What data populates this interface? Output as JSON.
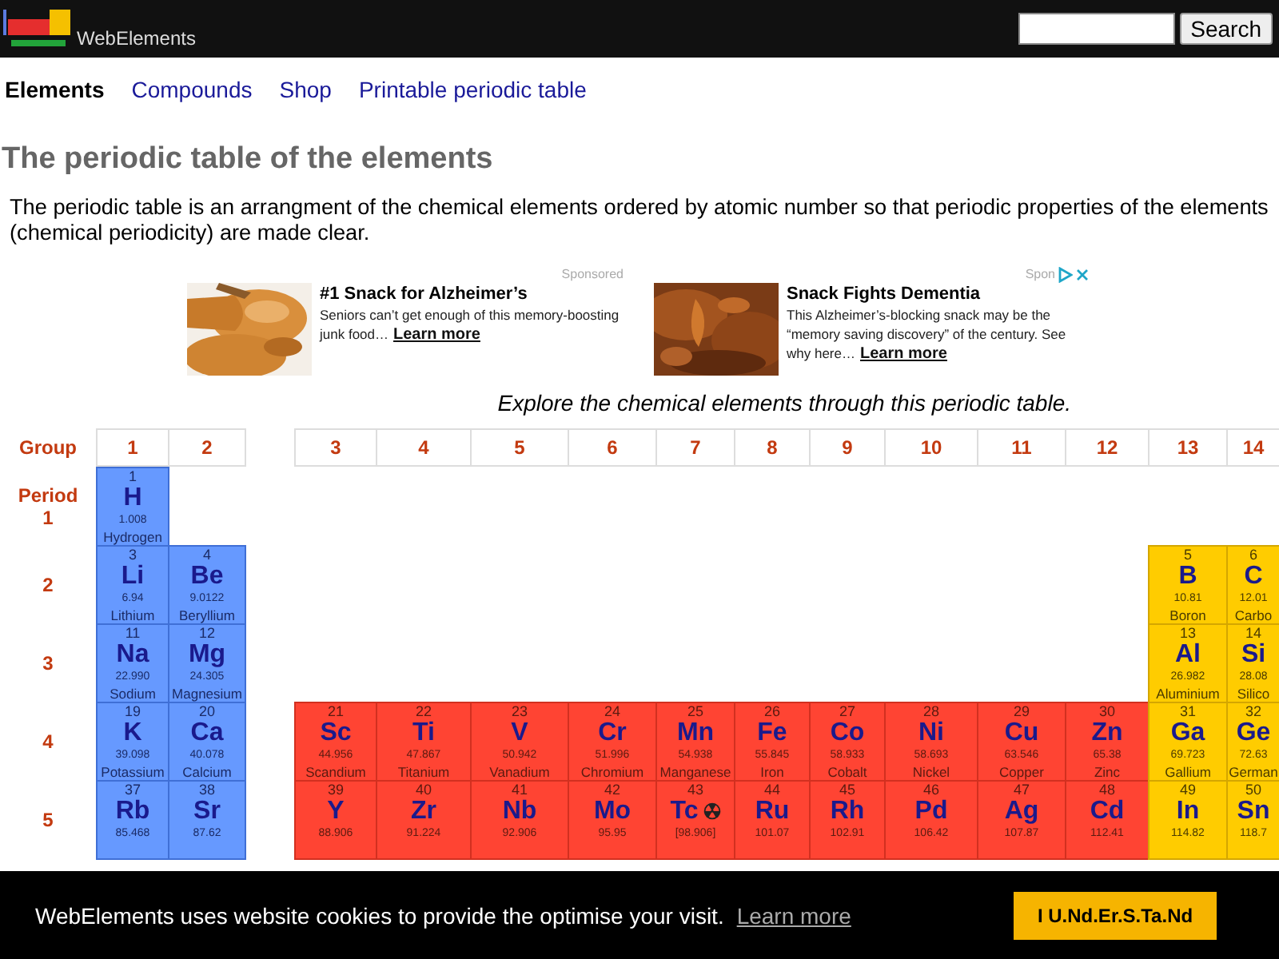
{
  "header": {
    "site_name": "WebElements",
    "search_button": "Search"
  },
  "nav": [
    {
      "label": "Elements",
      "selected": true
    },
    {
      "label": "Compounds",
      "selected": false
    },
    {
      "label": "Shop",
      "selected": false
    },
    {
      "label": "Printable periodic table",
      "selected": false
    }
  ],
  "title": "The periodic table of the elements",
  "intro": "The periodic table is an arrangment of the chemical elements ordered by atomic number so that periodic properties of the elements (chemical periodicity) are made clear.",
  "ads": [
    {
      "sponsored": "Sponsored",
      "title": "#1 Snack for Alzheimer’s",
      "text": "Seniors can’t get enough of this memory-boosting junk food…",
      "link": "Learn more",
      "ad_choices": false
    },
    {
      "sponsored": "Spon",
      "title": "Snack Fights Dementia",
      "text": "This Alzheimer’s-blocking snack may be the “memory saving discovery” of the century. See why here…",
      "link": "Learn more",
      "ad_choices": true
    }
  ],
  "explore": "Explore the chemical elements through this periodic table.",
  "table": {
    "group_label": "Group",
    "period_label": "Period",
    "groups": [
      "1",
      "2",
      "3",
      "4",
      "5",
      "6",
      "7",
      "8",
      "9",
      "10",
      "11",
      "12",
      "13",
      "14"
    ],
    "periods": [
      {
        "label": "1",
        "cells": [
          {
            "kind": "s-block",
            "number": "1",
            "symbol": "H",
            "weight": "1.008",
            "name": "Hydrogen"
          },
          {
            "kind": "empty"
          },
          {
            "kind": "empty"
          },
          {
            "kind": "empty"
          },
          {
            "kind": "empty"
          },
          {
            "kind": "empty"
          },
          {
            "kind": "empty"
          },
          {
            "kind": "empty"
          },
          {
            "kind": "empty"
          },
          {
            "kind": "empty"
          },
          {
            "kind": "empty"
          },
          {
            "kind": "empty"
          },
          {
            "kind": "empty"
          },
          {
            "kind": "empty"
          }
        ]
      },
      {
        "label": "2",
        "cells": [
          {
            "kind": "s-block",
            "number": "3",
            "symbol": "Li",
            "weight": "6.94",
            "name": "Lithium"
          },
          {
            "kind": "s-block",
            "number": "4",
            "symbol": "Be",
            "weight": "9.0122",
            "name": "Beryllium"
          },
          {
            "kind": "empty"
          },
          {
            "kind": "empty"
          },
          {
            "kind": "empty"
          },
          {
            "kind": "empty"
          },
          {
            "kind": "empty"
          },
          {
            "kind": "empty"
          },
          {
            "kind": "empty"
          },
          {
            "kind": "empty"
          },
          {
            "kind": "empty"
          },
          {
            "kind": "empty"
          },
          {
            "kind": "p-block",
            "number": "5",
            "symbol": "B",
            "weight": "10.81",
            "name": "Boron"
          },
          {
            "kind": "p-block",
            "number": "6",
            "symbol": "C",
            "weight": "12.01",
            "name": "Carbo"
          }
        ]
      },
      {
        "label": "3",
        "cells": [
          {
            "kind": "s-block",
            "number": "11",
            "symbol": "Na",
            "weight": "22.990",
            "name": "Sodium"
          },
          {
            "kind": "s-block",
            "number": "12",
            "symbol": "Mg",
            "weight": "24.305",
            "name": "Magnesium"
          },
          {
            "kind": "empty"
          },
          {
            "kind": "empty"
          },
          {
            "kind": "empty"
          },
          {
            "kind": "empty"
          },
          {
            "kind": "empty"
          },
          {
            "kind": "empty"
          },
          {
            "kind": "empty"
          },
          {
            "kind": "empty"
          },
          {
            "kind": "empty"
          },
          {
            "kind": "empty"
          },
          {
            "kind": "p-block",
            "number": "13",
            "symbol": "Al",
            "weight": "26.982",
            "name": "Aluminium"
          },
          {
            "kind": "p-block",
            "number": "14",
            "symbol": "Si",
            "weight": "28.08",
            "name": "Silico"
          }
        ]
      },
      {
        "label": "4",
        "cells": [
          {
            "kind": "s-block",
            "number": "19",
            "symbol": "K",
            "weight": "39.098",
            "name": "Potassium"
          },
          {
            "kind": "s-block",
            "number": "20",
            "symbol": "Ca",
            "weight": "40.078",
            "name": "Calcium"
          },
          {
            "kind": "d-block",
            "number": "21",
            "symbol": "Sc",
            "weight": "44.956",
            "name": "Scandium"
          },
          {
            "kind": "d-block",
            "number": "22",
            "symbol": "Ti",
            "weight": "47.867",
            "name": "Titanium"
          },
          {
            "kind": "d-block",
            "number": "23",
            "symbol": "V",
            "weight": "50.942",
            "name": "Vanadium"
          },
          {
            "kind": "d-block",
            "number": "24",
            "symbol": "Cr",
            "weight": "51.996",
            "name": "Chromium"
          },
          {
            "kind": "d-block",
            "number": "25",
            "symbol": "Mn",
            "weight": "54.938",
            "name": "Manganese"
          },
          {
            "kind": "d-block",
            "number": "26",
            "symbol": "Fe",
            "weight": "55.845",
            "name": "Iron"
          },
          {
            "kind": "d-block",
            "number": "27",
            "symbol": "Co",
            "weight": "58.933",
            "name": "Cobalt"
          },
          {
            "kind": "d-block",
            "number": "28",
            "symbol": "Ni",
            "weight": "58.693",
            "name": "Nickel"
          },
          {
            "kind": "d-block",
            "number": "29",
            "symbol": "Cu",
            "weight": "63.546",
            "name": "Copper"
          },
          {
            "kind": "d-block",
            "number": "30",
            "symbol": "Zn",
            "weight": "65.38",
            "name": "Zinc"
          },
          {
            "kind": "p-block",
            "number": "31",
            "symbol": "Ga",
            "weight": "69.723",
            "name": "Gallium"
          },
          {
            "kind": "p-block",
            "number": "32",
            "symbol": "Ge",
            "weight": "72.63",
            "name": "German"
          }
        ]
      },
      {
        "label": "5",
        "cells": [
          {
            "kind": "s-block",
            "number": "37",
            "symbol": "Rb",
            "weight": "85.468"
          },
          {
            "kind": "s-block",
            "number": "38",
            "symbol": "Sr",
            "weight": "87.62"
          },
          {
            "kind": "d-block",
            "number": "39",
            "symbol": "Y",
            "weight": "88.906"
          },
          {
            "kind": "d-block",
            "number": "40",
            "symbol": "Zr",
            "weight": "91.224"
          },
          {
            "kind": "d-block",
            "number": "41",
            "symbol": "Nb",
            "weight": "92.906"
          },
          {
            "kind": "d-block",
            "number": "42",
            "symbol": "Mo",
            "weight": "95.95"
          },
          {
            "kind": "d-block",
            "number": "43",
            "symbol": "Tc",
            "weight": "[98.906]",
            "radioactive": true
          },
          {
            "kind": "d-block",
            "number": "44",
            "symbol": "Ru",
            "weight": "101.07"
          },
          {
            "kind": "d-block",
            "number": "45",
            "symbol": "Rh",
            "weight": "102.91"
          },
          {
            "kind": "d-block",
            "number": "46",
            "symbol": "Pd",
            "weight": "106.42"
          },
          {
            "kind": "d-block",
            "number": "47",
            "symbol": "Ag",
            "weight": "107.87"
          },
          {
            "kind": "d-block",
            "number": "48",
            "symbol": "Cd",
            "weight": "112.41"
          },
          {
            "kind": "p-block",
            "number": "49",
            "symbol": "In",
            "weight": "114.82"
          },
          {
            "kind": "p-block",
            "number": "50",
            "symbol": "Sn",
            "weight": "118.7"
          }
        ]
      }
    ]
  },
  "cookie": {
    "text": "WebElements uses website cookies to provide the optimise your visit.",
    "link": "Learn more",
    "button": "I U.Nd.Er.S.Ta.Nd"
  }
}
